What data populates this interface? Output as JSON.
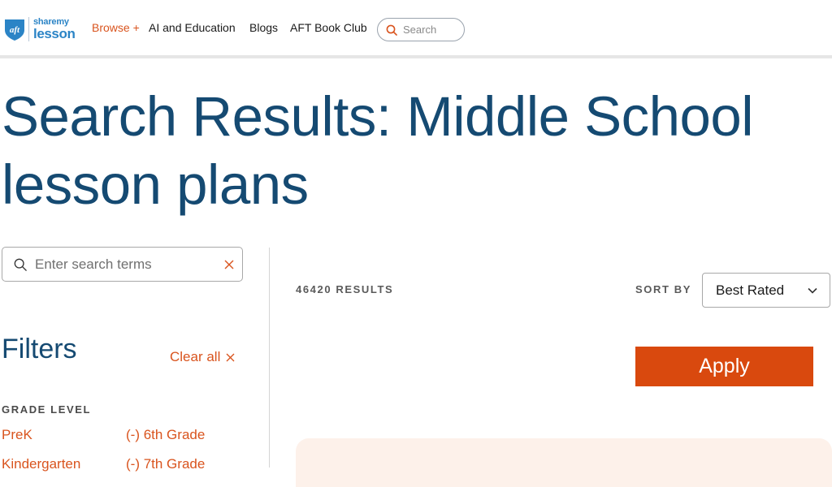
{
  "header": {
    "logo": {
      "badge_text": "aft",
      "top": "sharemy",
      "bottom": "lesson"
    },
    "nav": {
      "browse": "Browse +",
      "ai": "AI and Education",
      "blogs": "Blogs",
      "book_club": "AFT Book Club"
    },
    "search": {
      "placeholder": "Search",
      "icon": "search-icon"
    }
  },
  "page": {
    "title": "Search Results: Middle School lesson plans"
  },
  "sidebar": {
    "search": {
      "placeholder": "Enter search terms",
      "icon": "search-icon",
      "clear_icon": "close-icon"
    },
    "filters_heading": "Filters",
    "clear_all": "Clear all",
    "grade_level": {
      "heading": "GRADE LEVEL",
      "items": [
        "PreK",
        "(-) 6th Grade",
        "Kindergarten",
        "(-) 7th Grade"
      ]
    }
  },
  "results": {
    "count": "46420 RESULTS",
    "sort_label": "SORT BY",
    "sort_value": "Best Rated",
    "apply": "Apply"
  },
  "colors": {
    "brand_blue": "#154a72",
    "logo_blue": "#2b84c6",
    "accent_orange": "#d9541e",
    "apply_orange": "#d9490e",
    "card_bg": "#fdf1ea"
  }
}
